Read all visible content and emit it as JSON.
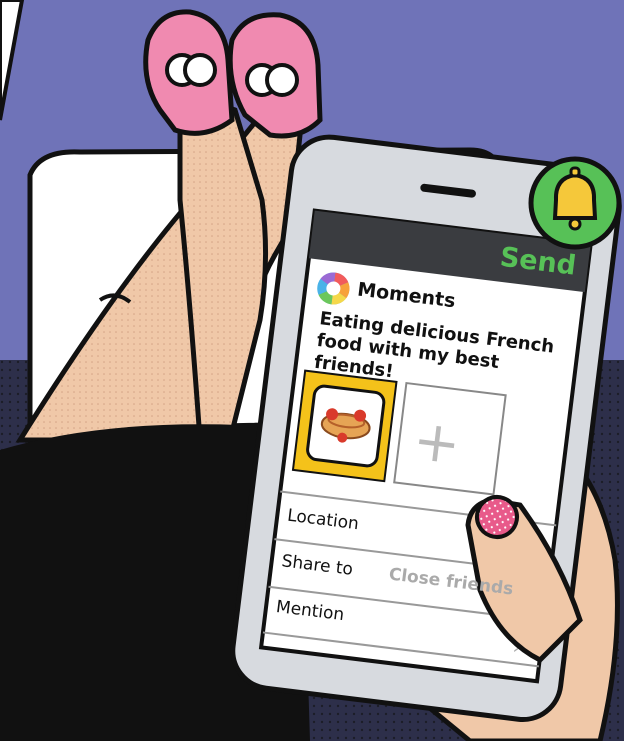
{
  "app": {
    "send_label": "Send",
    "moments_title": "Moments",
    "post_text_line1": "Eating delicious French",
    "post_text_line2": "food with my best",
    "post_text_line3": "friends!",
    "location_label": "Location",
    "share_to_label": "Share to",
    "share_to_value": "Close friends",
    "mention_label": "Mention"
  },
  "icons": {
    "bell": "bell-icon",
    "add_photo": "plus-icon",
    "moments_logo": "camera-aperture-icon",
    "chevron": "chevron-right-icon"
  },
  "colors": {
    "background": "#6f73b8",
    "accent_green": "#57c157",
    "bell_yellow": "#f5c83a",
    "slipper_pink": "#f08ab0",
    "skin": "#f0c8a8",
    "photo_tile_bg": "#f4c21a"
  }
}
